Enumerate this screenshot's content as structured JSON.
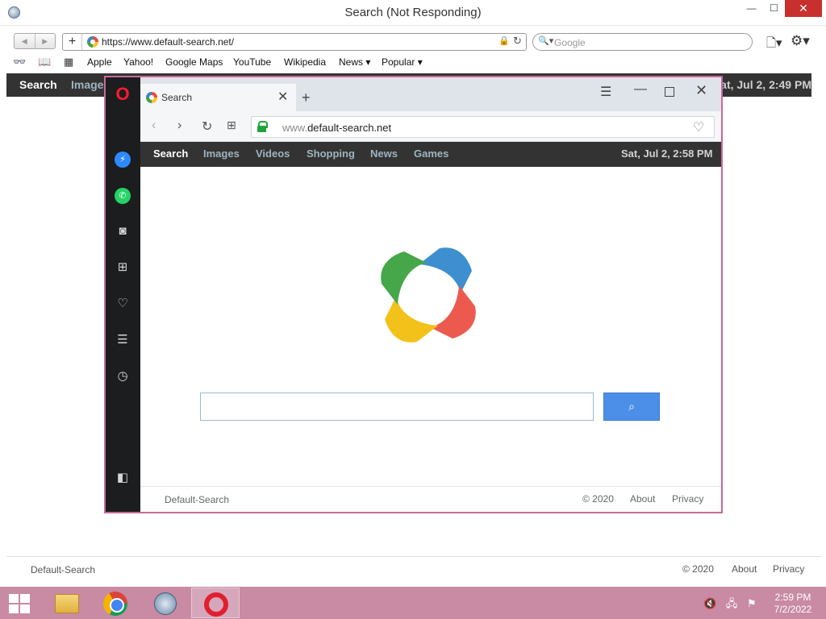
{
  "outer_window": {
    "title": "Search (Not Responding)",
    "controls": {
      "minimize": "—",
      "maximize": "☐",
      "close": "✕"
    },
    "address": {
      "url": "https://www.default-search.net/"
    },
    "search": {
      "placeholder": "Google"
    },
    "bookmarks": [
      "Apple",
      "Yahoo!",
      "Google Maps",
      "YouTube",
      "Wikipedia",
      "News ▾",
      "Popular ▾"
    ],
    "nav": {
      "tabs": [
        "Search",
        "Images"
      ],
      "date": "Sat, Jul 2, 2:49 PM"
    },
    "footer": {
      "brand": "Default-Search",
      "copyright": "© 2020",
      "about": "About",
      "privacy": "Privacy"
    }
  },
  "opera_window": {
    "tab": {
      "label": "Search"
    },
    "address": {
      "prefix": "www.",
      "host": "default-search.net"
    },
    "nav": {
      "tabs": [
        "Search",
        "Images",
        "Videos",
        "Shopping",
        "News",
        "Games"
      ],
      "date": "Sat, Jul 2, 2:58 PM"
    },
    "search": {
      "value": ""
    },
    "footer": {
      "brand": "Default-Search",
      "copyright": "© 2020",
      "about": "About",
      "privacy": "Privacy"
    }
  },
  "taskbar": {
    "apps": [
      "file-explorer",
      "chrome",
      "safari",
      "opera"
    ],
    "clock": {
      "time": "2:59 PM",
      "date": "7/2/2022"
    }
  },
  "colors": {
    "navbar_bg": "#333333",
    "nav_tab": "#9eb4bf",
    "opera_red": "#ff1b2d",
    "frame_border": "#c86a9b",
    "taskbar": "#c98aa3",
    "search_button": "#4c8fe8"
  }
}
